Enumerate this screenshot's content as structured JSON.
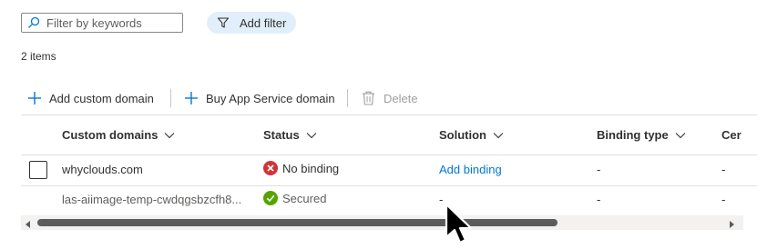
{
  "filter": {
    "search_placeholder": "Filter by keywords",
    "add_filter_label": "Add filter"
  },
  "item_count": "2 items",
  "toolbar": {
    "add_custom_domain": "Add custom domain",
    "buy_domain": "Buy App Service domain",
    "delete": "Delete"
  },
  "table": {
    "headers": {
      "custom_domains": "Custom domains",
      "status": "Status",
      "solution": "Solution",
      "binding_type": "Binding type",
      "cert": "Cer"
    },
    "rows": [
      {
        "domain": "whyclouds.com",
        "status": "No binding",
        "status_kind": "error",
        "solution": "Add binding",
        "binding_type": "-",
        "cert": "-"
      },
      {
        "domain": "las-aiimage-temp-cwdqgsbzcfh8...",
        "status": "Secured",
        "status_kind": "success",
        "solution": "-",
        "binding_type": "-",
        "cert": "-"
      }
    ]
  },
  "colors": {
    "accent": "#0078d4",
    "error": "#d13438",
    "success": "#57a300"
  }
}
